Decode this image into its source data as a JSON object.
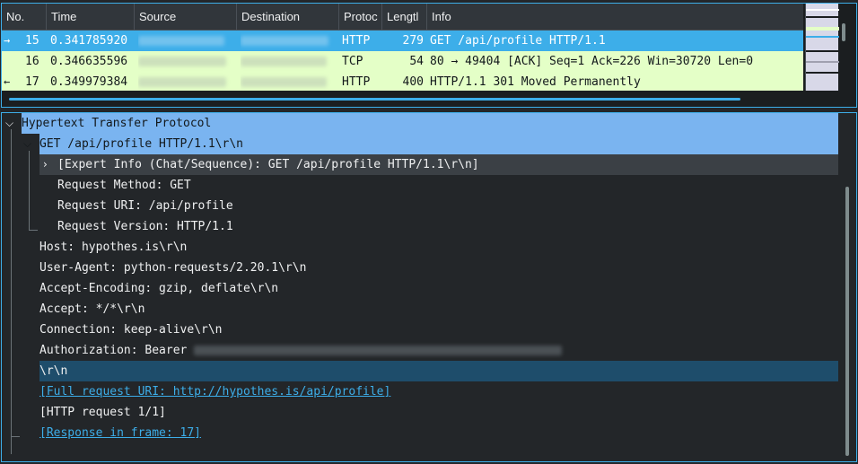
{
  "columns": [
    "No.",
    "Time",
    "Source",
    "Destination",
    "Protoc",
    "Lengtl",
    "Info"
  ],
  "packets": [
    {
      "no": "15",
      "time": "0.341785920",
      "proto": "HTTP",
      "length": "279",
      "info": "GET /api/profile HTTP/1.1"
    },
    {
      "no": "16",
      "time": "0.346635596",
      "proto": "TCP",
      "length": "54",
      "info": "80 → 49404 [ACK] Seq=1 Ack=226 Win=30720 Len=0"
    },
    {
      "no": "17",
      "time": "0.349979384",
      "proto": "HTTP",
      "length": "400",
      "info": "HTTP/1.1 301 Moved Permanently"
    }
  ],
  "details": {
    "root": "Hypertext Transfer Protocol",
    "request_line": "GET /api/profile HTTP/1.1\\r\\n",
    "expert_info": "[Expert Info (Chat/Sequence): GET /api/profile HTTP/1.1\\r\\n]",
    "request_method": "Request Method: GET",
    "request_uri": "Request URI: /api/profile",
    "request_version": "Request Version: HTTP/1.1",
    "host": "Host: hypothes.is\\r\\n",
    "user_agent": "User-Agent: python-requests/2.20.1\\r\\n",
    "accept_encoding": "Accept-Encoding: gzip, deflate\\r\\n",
    "accept": "Accept: */*\\r\\n",
    "connection": "Connection: keep-alive\\r\\n",
    "authorization": "Authorization: Bearer",
    "crlf": "\\r\\n",
    "full_uri": "[Full request URI: http://hypothes.is/api/profile]",
    "http_request": "[HTTP request 1/1]",
    "response_in": "[Response in frame: 17]"
  },
  "colors": {
    "accent": "#3daee9",
    "selected_row": "#3daee9",
    "http_row": "#e4ffc7",
    "tree_highlight": "#7ab4f0"
  }
}
